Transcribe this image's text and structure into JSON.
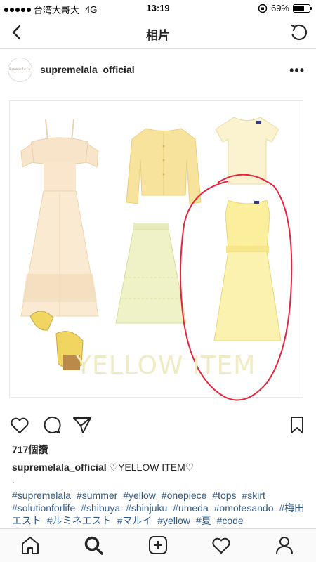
{
  "status_bar": {
    "carrier": "台湾大哥大",
    "network": "4G",
    "time": "13:19",
    "battery": "69%",
    "battery_level": 0.69
  },
  "nav": {
    "title": "相片",
    "back_icon": "chevron-left-icon",
    "refresh_icon": "refresh-icon"
  },
  "post": {
    "avatar_text": "Supreme La.La.",
    "username": "supremelala_official",
    "more_icon": "more-horizontal-icon",
    "image_caption": "YELLOW ITEM",
    "likes": "717個讚",
    "caption_username": "supremelala_official",
    "caption_text": "♡YELLOW ITEM♡",
    "caption_dot": ".",
    "hashtags": [
      "#supremelala",
      "#summer",
      "#yellow",
      "#onepiece",
      "#tops",
      "#skirt",
      "#solutionforlife",
      "#shibuya",
      "#shinjuku",
      "#umeda",
      "#omotesando",
      "#梅田エスト",
      "#ルミネエスト",
      "#マルイ",
      "#yellow",
      "#夏",
      "#code"
    ]
  },
  "colors": {
    "accent_link": "#2e5a8a",
    "circle_annotation": "#e8233c"
  }
}
